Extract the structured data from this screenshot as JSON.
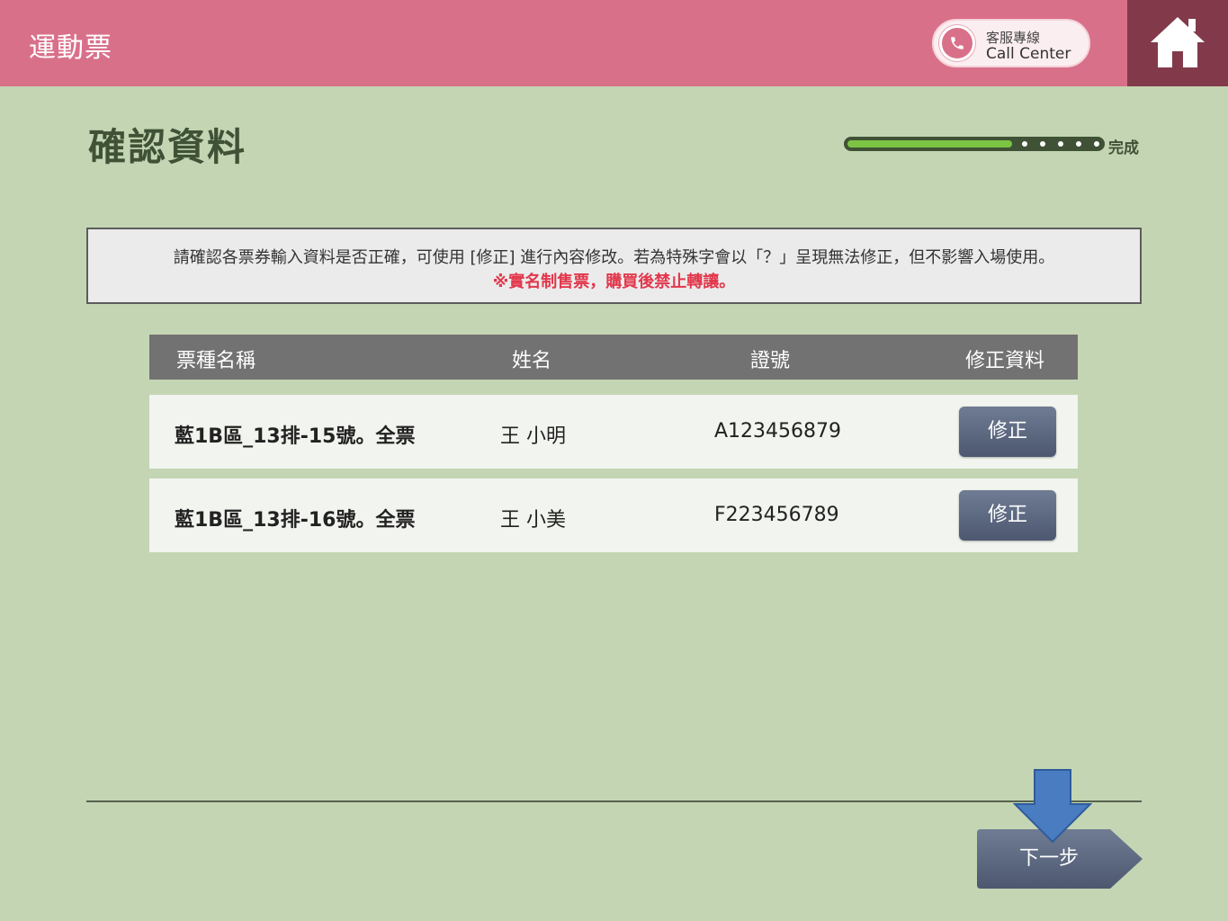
{
  "header": {
    "app_title": "運動票",
    "call_center_zh": "客服專線",
    "call_center_en": "Call Center"
  },
  "page": {
    "title": "確認資料"
  },
  "progress": {
    "label": "完成",
    "fraction": 0.65
  },
  "notice": {
    "line1": "請確認各票券輸入資料是否正確，可使用 [修正] 進行內容修改。若為特殊字會以「？」呈現無法修正，但不影響入場使用。",
    "line2": "※實名制售票，購買後禁止轉讓。"
  },
  "table": {
    "headers": [
      "票種名稱",
      "姓名",
      "證號",
      "修正資料"
    ],
    "rows": [
      {
        "ticket": "藍1B區_13排-15號。全票",
        "name": "王 小明",
        "id": "A123456879",
        "action": "修正"
      },
      {
        "ticket": "藍1B區_13排-16號。全票",
        "name": "王 小美",
        "id": "F223456789",
        "action": "修正"
      }
    ]
  },
  "footer": {
    "next_label": "下一步"
  },
  "icons": {
    "call": "phone-icon",
    "home": "home-icon",
    "arrow": "arrow-down-icon"
  },
  "colors": {
    "header": "#d97089",
    "home": "#823a4b",
    "background": "#c4d5b3",
    "progress_fill": "#7cc443",
    "warning_text": "#e2374c",
    "button": "#5b667e",
    "arrow": "#4a7cc2"
  }
}
